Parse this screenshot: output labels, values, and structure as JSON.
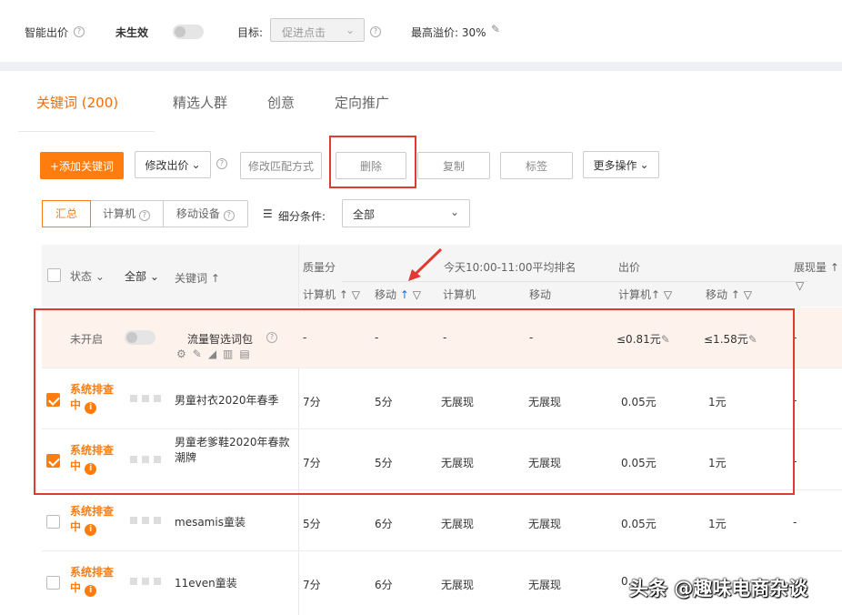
{
  "topbar": {
    "smart_bid_label": "智能出价",
    "status_text": "未生效",
    "target_label": "目标:",
    "target_value": "促进点击",
    "max_premium": "最高溢价: 30%"
  },
  "tabs": [
    "关键词 (200)",
    "精选人群",
    "创意",
    "定向推广"
  ],
  "toolbar": {
    "add_keyword": "+添加关键词",
    "modify_bid": "修改出价",
    "modify_match": "修改匹配方式",
    "delete": "删除",
    "copy": "复制",
    "tag": "标签",
    "more_ops": "更多操作"
  },
  "segments": {
    "summary": "汇总",
    "computer": "计算机",
    "mobile": "移动设备",
    "filter_label": "细分条件:",
    "filter_value": "全部"
  },
  "table": {
    "headers": {
      "status": "状态",
      "all": "全部",
      "keyword": "关键词",
      "quality": "质量分",
      "quality_pc": "计算机",
      "quality_mobile": "移动",
      "rank_title": "今天10:00-11:00平均排名",
      "rank_pc": "计算机",
      "rank_mobile": "移动",
      "bid_title": "出价",
      "bid_pc": "计算机",
      "bid_mobile": "移动",
      "impressions": "展现量"
    },
    "package_row": {
      "status": "未开启",
      "name": "流量智选词包",
      "q_pc": "-",
      "q_mobile": "-",
      "r_pc": "-",
      "r_mobile": "-",
      "bid_pc": "≤0.81元",
      "bid_mobile": "≤1.58元",
      "impressions": "-"
    },
    "rows": [
      {
        "status": "系统排查中",
        "keyword": "男童衬衣2020年春季",
        "q_pc": "7分",
        "q_mobile": "5分",
        "r_pc": "无展现",
        "r_mobile": "无展现",
        "bid_pc": "0.05元",
        "bid_mobile": "1元",
        "impressions": "-"
      },
      {
        "status": "系统排查中",
        "keyword": "男童老爹鞋2020年春款潮牌",
        "q_pc": "7分",
        "q_mobile": "5分",
        "r_pc": "无展现",
        "r_mobile": "无展现",
        "bid_pc": "0.05元",
        "bid_mobile": "1元",
        "impressions": "-"
      },
      {
        "status": "系统排查中",
        "keyword": "mesamis童装",
        "q_pc": "5分",
        "q_mobile": "6分",
        "r_pc": "无展现",
        "r_mobile": "无展现",
        "bid_pc": "0.05元",
        "bid_mobile": "1元",
        "impressions": "-"
      },
      {
        "status": "系统排查中",
        "keyword": "11even童装",
        "q_pc": "7分",
        "q_mobile": "6分",
        "r_pc": "无展现",
        "r_mobile": "无展现",
        "bid_pc": "0.",
        "bid_mobile": "",
        "impressions": ""
      }
    ]
  },
  "watermark": "头条 @趣味电商杂谈",
  "colors": {
    "accent": "#ff7d0f",
    "highlight_box": "#e03a35",
    "sort_active": "#1e6fd9"
  }
}
